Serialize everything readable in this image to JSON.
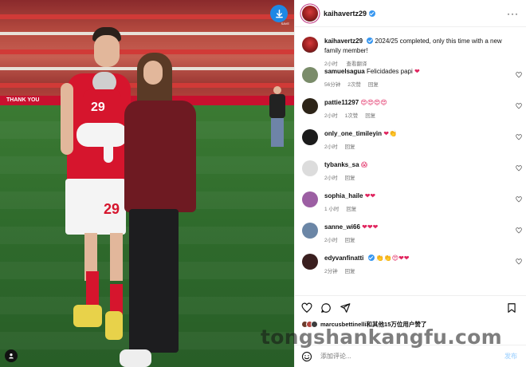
{
  "post": {
    "username": "kaihavertz29",
    "more_label": "···",
    "caption_text": "2024/25 completed, only this time with a new family member!",
    "caption_time": "2小时",
    "caption_translate": "查看翻译"
  },
  "photo": {
    "stadium_banner": "THANK YOU",
    "player_number": "29",
    "baby_number": "29",
    "download_label": "SAVE"
  },
  "comments": [
    {
      "username": "samuelsagua",
      "text": "Felicidades papi",
      "emoji": "❤",
      "time": "56分钟",
      "likes": "2次赞",
      "reply": "回复",
      "avatar_color": "#7a8c6a"
    },
    {
      "username": "pattie11297",
      "text": "",
      "emoji": "😍😍😍😍",
      "time": "2小时",
      "likes": "1次赞",
      "reply": "回复",
      "avatar_color": "#2d2418"
    },
    {
      "username": "only_one_timileyin",
      "text": "",
      "emoji": "❤👏",
      "time": "2小时",
      "likes": "",
      "reply": "回复",
      "avatar_color": "#1b1b1b"
    },
    {
      "username": "tybanks_sa",
      "text": "",
      "emoji": "😱",
      "time": "2小时",
      "likes": "",
      "reply": "回复",
      "avatar_color": "#dcdcdc"
    },
    {
      "username": "sophia_haile",
      "text": "",
      "emoji": "❤❤",
      "time": "1 小时",
      "likes": "",
      "reply": "回复",
      "avatar_color": "#9c5fa3"
    },
    {
      "username": "sanne_wi66",
      "text": "",
      "emoji": "❤❤❤",
      "time": "2小时",
      "likes": "",
      "reply": "回复",
      "avatar_color": "#6b86a6"
    },
    {
      "username": "edyvanfinatti",
      "text": "",
      "emoji": "👏👏😍❤❤",
      "time": "2分钟",
      "likes": "",
      "reply": "回复",
      "avatar_color": "#3a1f1f"
    }
  ],
  "likes": {
    "text": "marcusbettinelli和其他15万位用户赞了"
  },
  "add_comment": {
    "placeholder": "添加评论...",
    "post_label": "发布"
  },
  "watermark": "tongshankangfu.com",
  "colors": {
    "verified": "#3897f0",
    "heart": "#e0245e",
    "arsenal_red": "#d6152d",
    "link_blue": "#b3dbff"
  }
}
